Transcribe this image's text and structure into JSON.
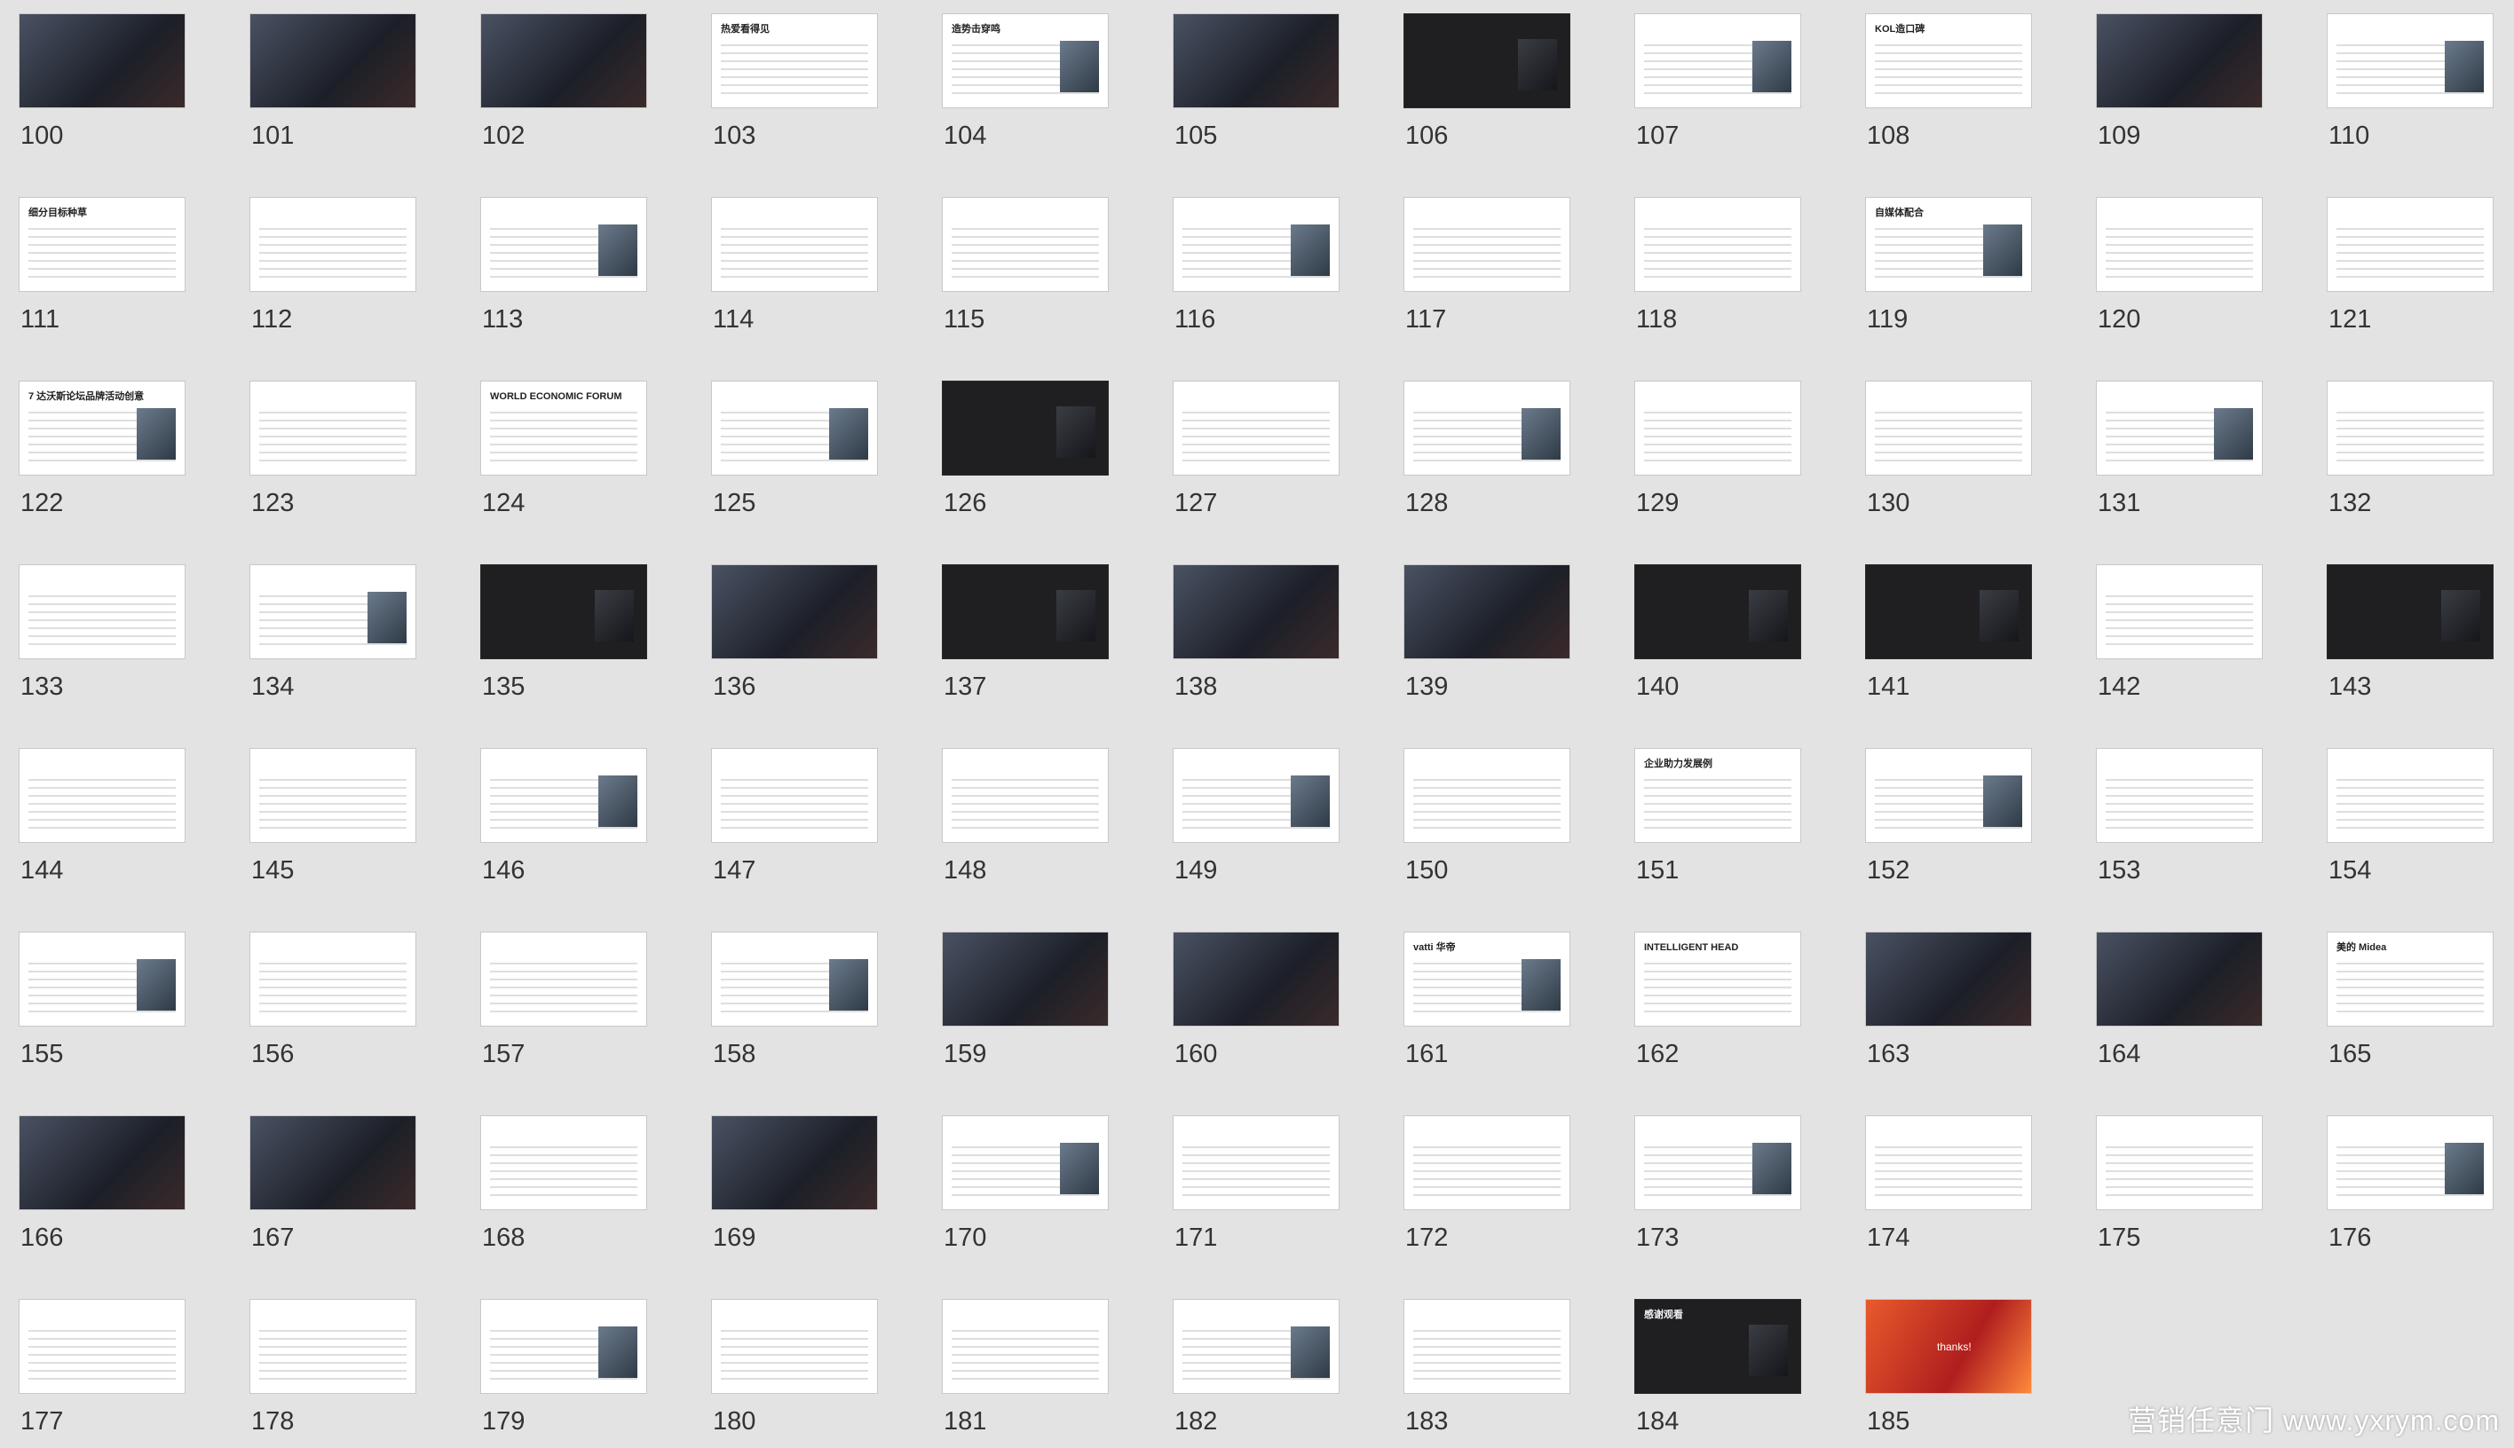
{
  "slides": [
    {
      "number": "100",
      "title": "",
      "style": "photo"
    },
    {
      "number": "101",
      "title": "",
      "style": "photo"
    },
    {
      "number": "102",
      "title": "",
      "style": "photo"
    },
    {
      "number": "103",
      "title": "热爱看得见",
      "style": "text"
    },
    {
      "number": "104",
      "title": "造势击穿鸣",
      "style": "text"
    },
    {
      "number": "105",
      "title": "",
      "style": "photo"
    },
    {
      "number": "106",
      "title": "",
      "style": "dark"
    },
    {
      "number": "107",
      "title": "",
      "style": "text"
    },
    {
      "number": "108",
      "title": "KOL造口碑",
      "style": "text"
    },
    {
      "number": "109",
      "title": "",
      "style": "photo"
    },
    {
      "number": "110",
      "title": "",
      "style": "text"
    },
    {
      "number": "111",
      "title": "细分目标种草",
      "style": "text"
    },
    {
      "number": "112",
      "title": "",
      "style": "text"
    },
    {
      "number": "113",
      "title": "",
      "style": "text"
    },
    {
      "number": "114",
      "title": "",
      "style": "text"
    },
    {
      "number": "115",
      "title": "",
      "style": "text"
    },
    {
      "number": "116",
      "title": "",
      "style": "text"
    },
    {
      "number": "117",
      "title": "",
      "style": "text"
    },
    {
      "number": "118",
      "title": "",
      "style": "text"
    },
    {
      "number": "119",
      "title": "自媒体配合",
      "style": "text"
    },
    {
      "number": "120",
      "title": "",
      "style": "text"
    },
    {
      "number": "121",
      "title": "",
      "style": "text"
    },
    {
      "number": "122",
      "title": "7 达沃斯论坛品牌活动创意",
      "style": "text"
    },
    {
      "number": "123",
      "title": "",
      "style": "text"
    },
    {
      "number": "124",
      "title": "WORLD ECONOMIC FORUM",
      "style": "text"
    },
    {
      "number": "125",
      "title": "",
      "style": "text"
    },
    {
      "number": "126",
      "title": "",
      "style": "dark"
    },
    {
      "number": "127",
      "title": "",
      "style": "text"
    },
    {
      "number": "128",
      "title": "",
      "style": "text"
    },
    {
      "number": "129",
      "title": "",
      "style": "text"
    },
    {
      "number": "130",
      "title": "",
      "style": "text"
    },
    {
      "number": "131",
      "title": "",
      "style": "text"
    },
    {
      "number": "132",
      "title": "",
      "style": "text"
    },
    {
      "number": "133",
      "title": "",
      "style": "text"
    },
    {
      "number": "134",
      "title": "",
      "style": "text"
    },
    {
      "number": "135",
      "title": "",
      "style": "dark"
    },
    {
      "number": "136",
      "title": "",
      "style": "photo"
    },
    {
      "number": "137",
      "title": "",
      "style": "dark"
    },
    {
      "number": "138",
      "title": "",
      "style": "photo"
    },
    {
      "number": "139",
      "title": "",
      "style": "photo"
    },
    {
      "number": "140",
      "title": "",
      "style": "dark"
    },
    {
      "number": "141",
      "title": "",
      "style": "dark"
    },
    {
      "number": "142",
      "title": "",
      "style": "text"
    },
    {
      "number": "143",
      "title": "",
      "style": "dark"
    },
    {
      "number": "144",
      "title": "",
      "style": "text"
    },
    {
      "number": "145",
      "title": "",
      "style": "text"
    },
    {
      "number": "146",
      "title": "",
      "style": "text"
    },
    {
      "number": "147",
      "title": "",
      "style": "text"
    },
    {
      "number": "148",
      "title": "",
      "style": "text"
    },
    {
      "number": "149",
      "title": "",
      "style": "text"
    },
    {
      "number": "150",
      "title": "",
      "style": "text"
    },
    {
      "number": "151",
      "title": "企业助力发展例",
      "style": "text"
    },
    {
      "number": "152",
      "title": "",
      "style": "text"
    },
    {
      "number": "153",
      "title": "",
      "style": "text"
    },
    {
      "number": "154",
      "title": "",
      "style": "text"
    },
    {
      "number": "155",
      "title": "",
      "style": "text"
    },
    {
      "number": "156",
      "title": "",
      "style": "text"
    },
    {
      "number": "157",
      "title": "",
      "style": "text"
    },
    {
      "number": "158",
      "title": "",
      "style": "text"
    },
    {
      "number": "159",
      "title": "",
      "style": "photo"
    },
    {
      "number": "160",
      "title": "",
      "style": "photo"
    },
    {
      "number": "161",
      "title": "vatti 华帝",
      "style": "text"
    },
    {
      "number": "162",
      "title": "INTELLIGENT HEAD",
      "style": "text"
    },
    {
      "number": "163",
      "title": "",
      "style": "photo"
    },
    {
      "number": "164",
      "title": "",
      "style": "photo"
    },
    {
      "number": "165",
      "title": "美的 Midea",
      "style": "text"
    },
    {
      "number": "166",
      "title": "",
      "style": "photo"
    },
    {
      "number": "167",
      "title": "",
      "style": "photo"
    },
    {
      "number": "168",
      "title": "",
      "style": "text"
    },
    {
      "number": "169",
      "title": "",
      "style": "photo"
    },
    {
      "number": "170",
      "title": "",
      "style": "text"
    },
    {
      "number": "171",
      "title": "",
      "style": "text"
    },
    {
      "number": "172",
      "title": "",
      "style": "text"
    },
    {
      "number": "173",
      "title": "",
      "style": "text"
    },
    {
      "number": "174",
      "title": "",
      "style": "text"
    },
    {
      "number": "175",
      "title": "",
      "style": "text"
    },
    {
      "number": "176",
      "title": "",
      "style": "text"
    },
    {
      "number": "177",
      "title": "",
      "style": "text"
    },
    {
      "number": "178",
      "title": "",
      "style": "text"
    },
    {
      "number": "179",
      "title": "",
      "style": "text"
    },
    {
      "number": "180",
      "title": "",
      "style": "text"
    },
    {
      "number": "181",
      "title": "",
      "style": "text"
    },
    {
      "number": "182",
      "title": "",
      "style": "text"
    },
    {
      "number": "183",
      "title": "",
      "style": "text"
    },
    {
      "number": "184",
      "title": "感谢观看",
      "style": "dark"
    },
    {
      "number": "185",
      "title": "thanks!",
      "style": "red"
    }
  ],
  "watermark": "营销任意门 www.yxrym.com"
}
